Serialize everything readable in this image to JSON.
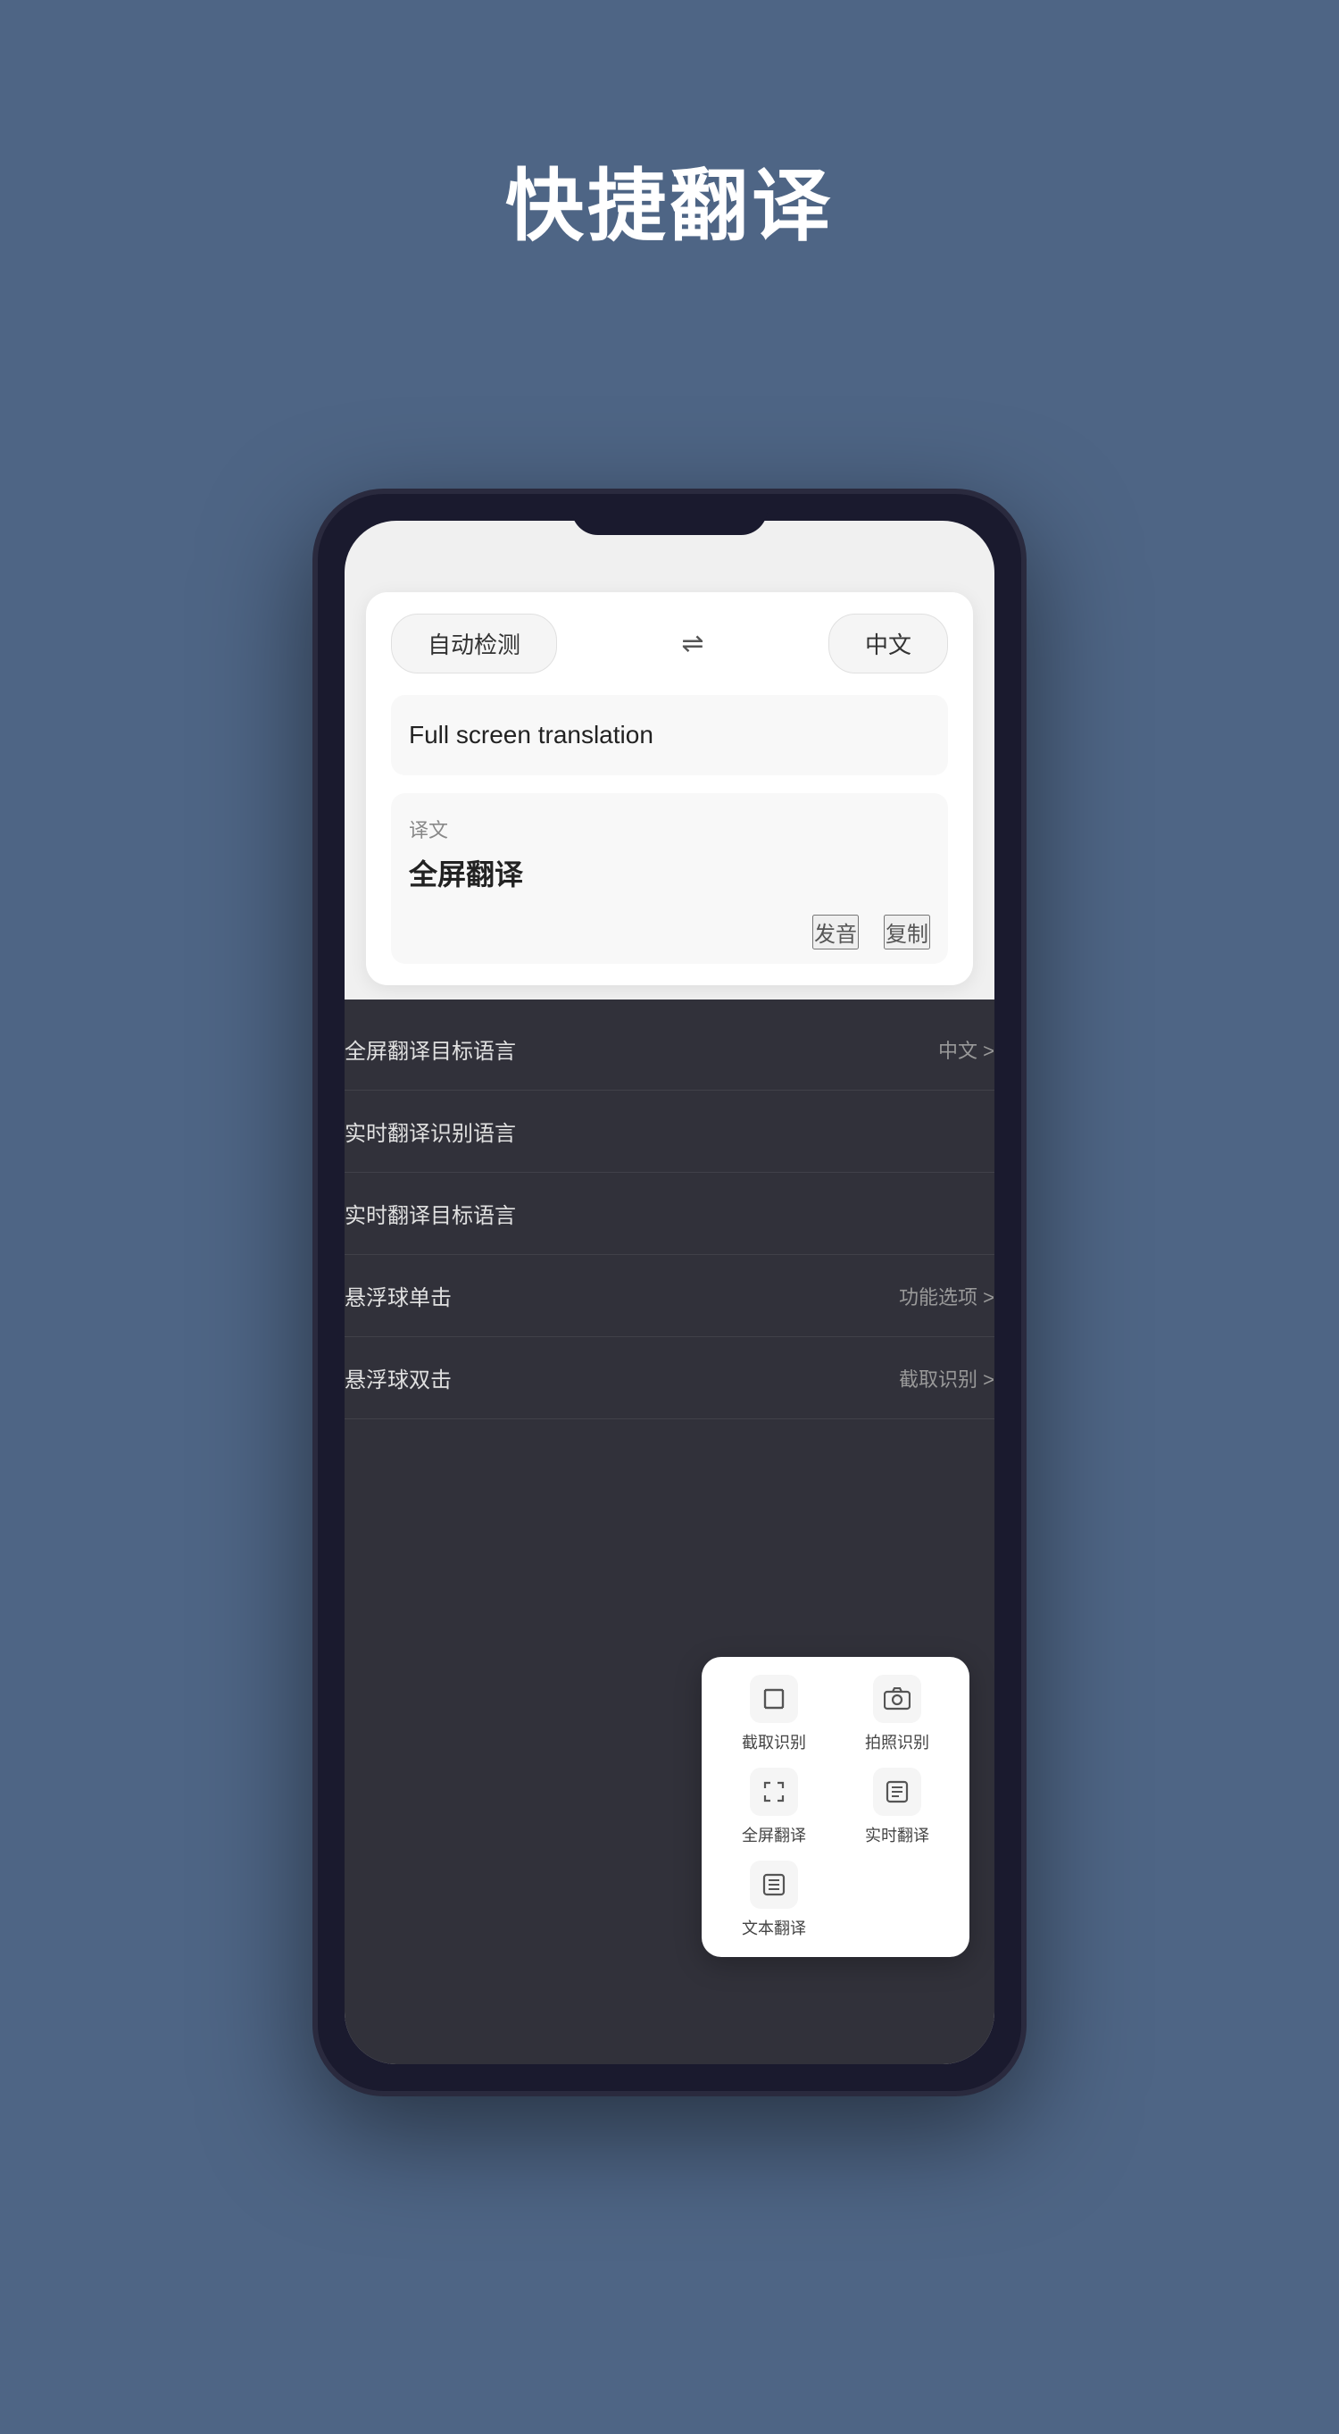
{
  "page": {
    "title": "快捷翻译",
    "background_color": "#4e6585"
  },
  "phone": {
    "translation_card": {
      "source_lang": "自动检测",
      "swap_symbol": "⇌",
      "target_lang": "中文",
      "input_text": "Full screen translation",
      "result_label": "译文",
      "result_text": "全屏翻译",
      "action_pronounce": "发音",
      "action_copy": "复制"
    },
    "settings": [
      {
        "label": "全屏翻译目标语言",
        "value": "中文 >"
      },
      {
        "label": "实时翻译识别语言",
        "value": ""
      },
      {
        "label": "实时翻译目标语言",
        "value": ""
      },
      {
        "label": "悬浮球单击",
        "value": "功能选项 >"
      },
      {
        "label": "悬浮球双击",
        "value": "截取识别 >"
      }
    ],
    "quick_actions": [
      {
        "id": "crop",
        "label": "截取识别",
        "icon": "✂"
      },
      {
        "id": "camera",
        "label": "拍照识别",
        "icon": "📷"
      },
      {
        "id": "fullscreen",
        "label": "全屏翻译",
        "icon": "⛶"
      },
      {
        "id": "realtime",
        "label": "实时翻译",
        "icon": "📋"
      },
      {
        "id": "text",
        "label": "文本翻译",
        "icon": "📄"
      }
    ]
  }
}
